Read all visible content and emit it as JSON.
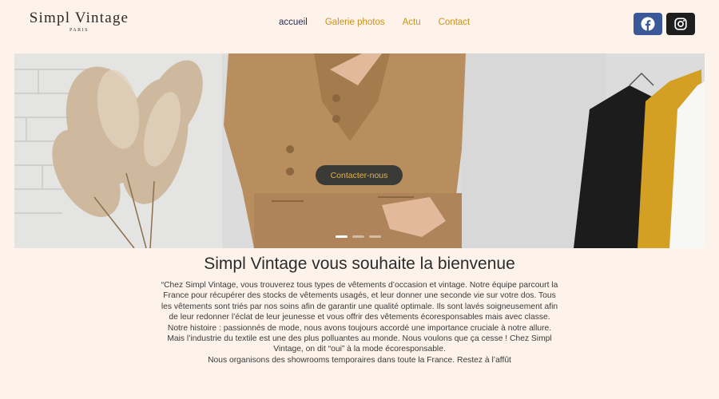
{
  "logo": {
    "title": "Simpl Vintage",
    "subtitle": "PARIS"
  },
  "nav": {
    "items": [
      {
        "label": "accueil",
        "active": true
      },
      {
        "label": "Galerie photos",
        "active": false
      },
      {
        "label": "Actu",
        "active": false
      },
      {
        "label": "Contact",
        "active": false
      }
    ]
  },
  "social": [
    {
      "icon": "facebook-icon",
      "color": "#3b5998"
    },
    {
      "icon": "instagram-icon",
      "color": "#1e1e1e"
    }
  ],
  "hero": {
    "cta_label": "Contacter-nous",
    "slides": 3,
    "active_slide": 1
  },
  "welcome": {
    "title": "Simpl Vintage vous souhaite la bienvenue",
    "paragraphs": [
      "“Chez Simpl Vintage, vous trouverez tous types de vêtements d’occasion et vintage. Notre équipe parcourt la France pour récupérer des stocks de vêtements usagés, et leur donner une seconde vie sur votre dos. Tous les vêtements sont triés par nos soins afin de garantir une qualité optimale. Ils sont lavés soigneusement afin de leur redonner l’éclat de leur jeunesse et vous offrir des vêtements écoresponsables mais avec classe.",
      "Notre histoire : passionnés de mode, nous avons toujours accordé une importance cruciale à notre allure. Mais l’industrie du textile est une des plus polluantes au monde. Nous voulons que ça cesse ! Chez Simpl Vintage, on dit “oui” à la mode écoresponsable.",
      "Nous organisons des showrooms temporaires dans toute la France. Restez à l’affût"
    ]
  },
  "colors": {
    "background": "#fdf3ea",
    "nav_active": "#2b2d4f",
    "nav_link": "#c8921f",
    "cta_text": "#e0b347"
  }
}
